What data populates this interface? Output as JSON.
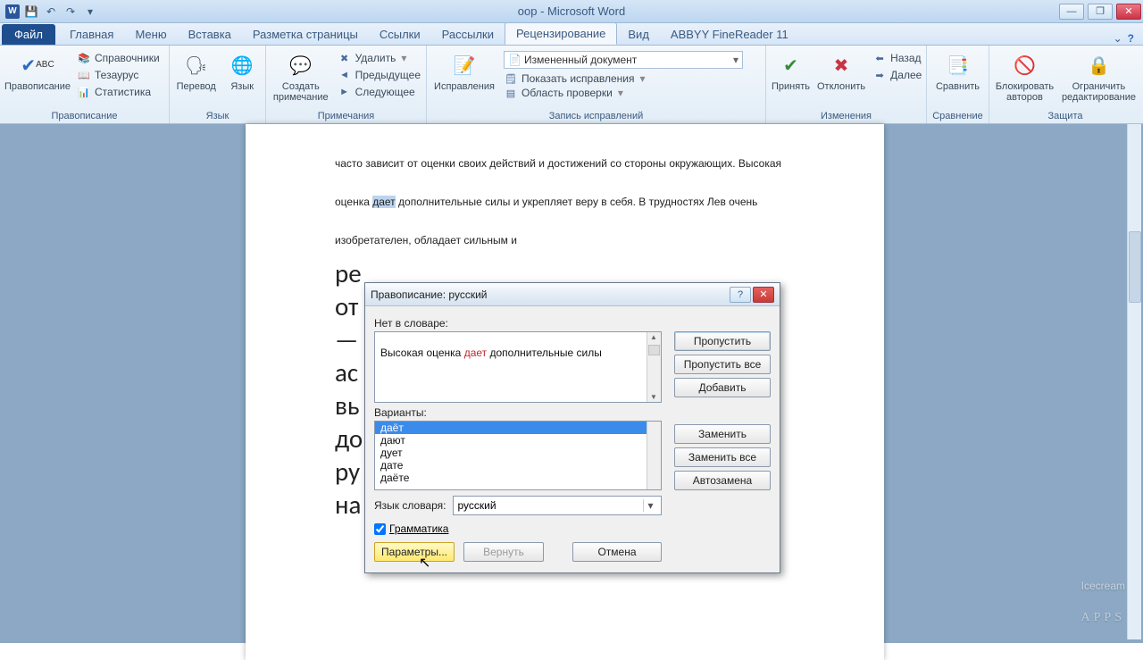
{
  "app": {
    "title": "оор  -  Microsoft Word"
  },
  "tabs": {
    "file": "Файл",
    "items": [
      "Главная",
      "Меню",
      "Вставка",
      "Разметка страницы",
      "Ссылки",
      "Рассылки",
      "Рецензирование",
      "Вид",
      "ABBYY FineReader 11"
    ],
    "active_index": 6
  },
  "ribbon": {
    "spelling": {
      "big": "Правописание",
      "ref": "Справочники",
      "thes": "Тезаурус",
      "stats": "Статистика",
      "group": "Правописание"
    },
    "language": {
      "translate": "Перевод",
      "lang": "Язык",
      "group": "Язык"
    },
    "comments": {
      "new": "Создать примечание",
      "delete": "Удалить",
      "prev": "Предыдущее",
      "next": "Следующее",
      "group": "Примечания"
    },
    "tracking": {
      "big": "Исправления",
      "dd": "Измененный документ",
      "show": "Показать исправления",
      "area": "Область проверки",
      "group": "Запись исправлений"
    },
    "changes": {
      "accept": "Принять",
      "reject": "Отклонить",
      "back": "Назад",
      "forward": "Далее",
      "group": "Изменения"
    },
    "compare": {
      "label": "Сравнить",
      "group": "Сравнение"
    },
    "protect": {
      "block": "Блокировать авторов",
      "restrict": "Ограничить редактирование",
      "group": "Защита"
    }
  },
  "document": {
    "p1a": "часто зависит от оценки своих действий и достижений со стороны окружающих. Высокая оценка ",
    "p1hl": "дает",
    "p1b": " дополнительные силы и укрепляет веру в себя. В трудностях Лев очень изобретателен, обладает сильным и",
    "p2": "ре",
    "p3": "от                                                                          Лев",
    "p4": "—",
    "p5": "ас",
    "p6": "вь",
    "p7": "до                                                                         ся",
    "p8": "ру",
    "p9": "на"
  },
  "dialog": {
    "title": "Правописание: русский",
    "not_in_dict": "Нет в словаре:",
    "sentence_pre": "Высокая оценка ",
    "sentence_err": "дает",
    "sentence_post": " дополнительные силы",
    "suggestions_label": "Варианты:",
    "suggestions": [
      "даёт",
      "дают",
      "дует",
      "дате",
      "даёте"
    ],
    "selected_suggestion_index": 0,
    "dict_lang_label": "Язык словаря:",
    "dict_lang_value": "русский",
    "grammar_label": "Грамматика",
    "grammar_checked": true,
    "buttons": {
      "ignore": "Пропустить",
      "ignore_all": "Пропустить все",
      "add": "Добавить",
      "change": "Заменить",
      "change_all": "Заменить все",
      "autocorrect": "Автозамена",
      "options": "Параметры...",
      "undo": "Вернуть",
      "cancel": "Отмена"
    }
  },
  "watermark": {
    "brand": "Icecream",
    "sub": "APPS"
  }
}
